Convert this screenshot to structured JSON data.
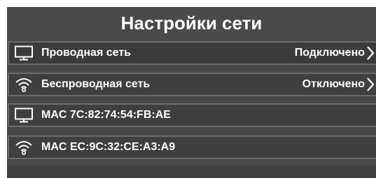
{
  "header": {
    "title": "Настройки сети"
  },
  "rows": [
    {
      "label": "Проводная сеть",
      "status": "Подключено",
      "icon": "monitor-icon"
    },
    {
      "label": "Беспроводная сеть",
      "status": "Отключено",
      "icon": "wifi-icon"
    },
    {
      "label": "MAC 7C:82:74:54:FB:AE",
      "icon": "monitor-icon"
    },
    {
      "label": "MAC EC:9C:32:CE:A3:A9",
      "icon": "wifi-icon"
    }
  ],
  "colors": {
    "panel": "#484848",
    "row_border": "#6b6b6b",
    "text": "#ffffff"
  }
}
